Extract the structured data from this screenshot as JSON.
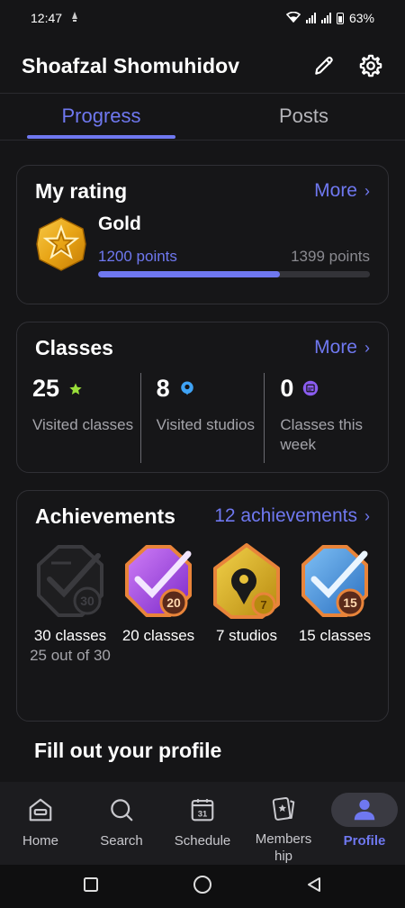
{
  "status": {
    "time": "12:47",
    "battery": "63%"
  },
  "header": {
    "title": "Shoafzal Shomuhidov",
    "edit_icon": "pencil-icon",
    "settings_icon": "gear-icon"
  },
  "tabs": [
    {
      "label": "Progress",
      "active": true
    },
    {
      "label": "Posts",
      "active": false
    }
  ],
  "rating": {
    "title": "My rating",
    "more_label": "More",
    "rank": "Gold",
    "points_label": "1200 points",
    "max_label": "1399 points",
    "progress": 0.67
  },
  "classes": {
    "title": "Classes",
    "more_label": "More",
    "stats": [
      {
        "value": "25",
        "label": "Visited classes",
        "icon": "star-icon"
      },
      {
        "value": "8",
        "label": "Visited studios",
        "icon": "location-pin-icon"
      },
      {
        "value": "0",
        "label": "Classes this week",
        "icon": "calendar-icon"
      }
    ]
  },
  "achievements": {
    "title": "Achievements",
    "link_label": "12 achievements",
    "items": [
      {
        "label": "30 classes",
        "sub": "25 out of 30",
        "badge": "30",
        "locked": true
      },
      {
        "label": "20 classes",
        "sub": "",
        "badge": "20",
        "locked": false
      },
      {
        "label": "7 studios",
        "sub": "",
        "badge": "7",
        "locked": false
      },
      {
        "label": "15 classes",
        "sub": "",
        "badge": "15",
        "locked": false
      }
    ]
  },
  "fill_profile": {
    "title": "Fill out your profile"
  },
  "nav": [
    {
      "label": "Home",
      "icon": "home-icon"
    },
    {
      "label": "Search",
      "icon": "search-icon"
    },
    {
      "label": "Schedule",
      "icon": "calendar-icon",
      "day": "31"
    },
    {
      "label": "Members hip",
      "icon": "membership-card-icon"
    },
    {
      "label": "Profile",
      "icon": "profile-icon",
      "active": true
    }
  ],
  "colors": {
    "accent": "#6f78f0",
    "background": "#151517",
    "card_border": "#303035"
  }
}
